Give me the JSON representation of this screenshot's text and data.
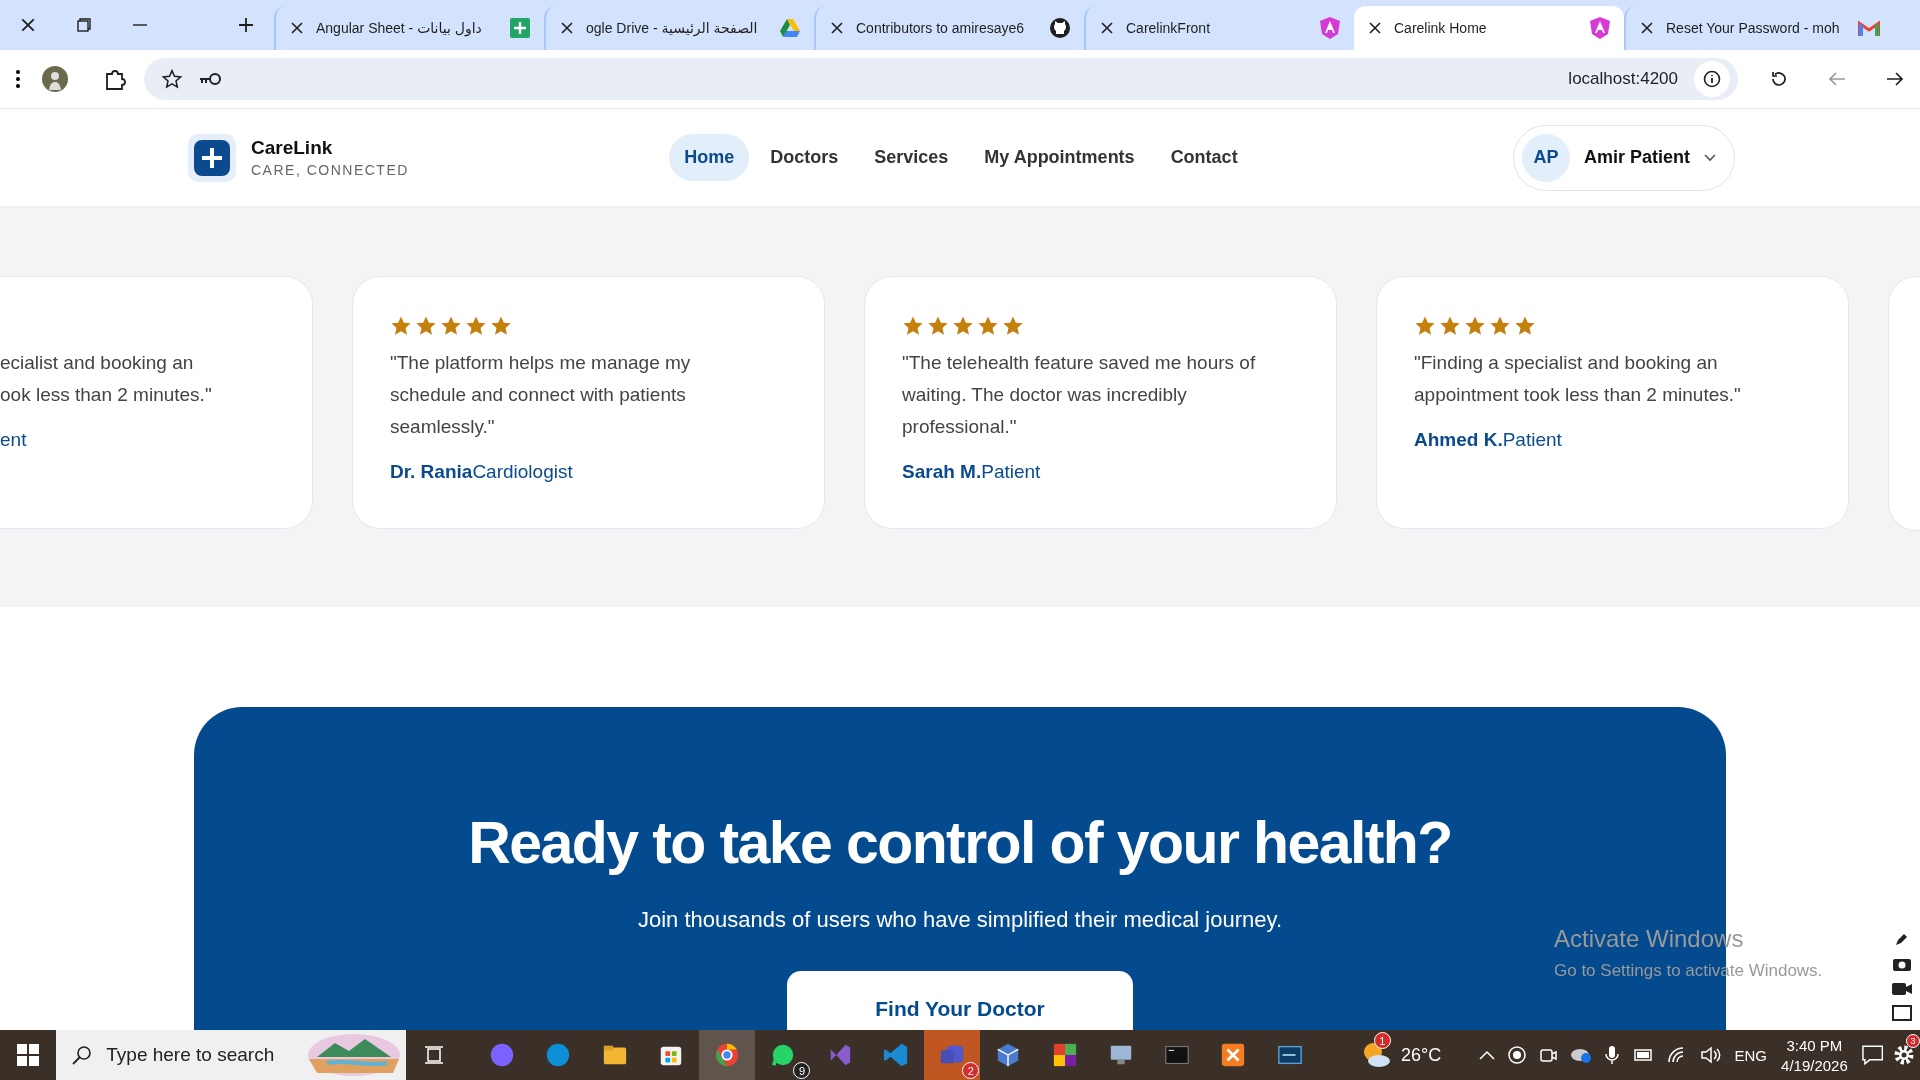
{
  "browser": {
    "tabs": [
      {
        "title": "Angular Sheet - داول بيانات",
        "selected": false
      },
      {
        "title": "ogle Drive - الصفحة الرئيسية",
        "selected": false
      },
      {
        "title": "Contributors to amiresaye6",
        "selected": false
      },
      {
        "title": "CarelinkFront",
        "selected": false
      },
      {
        "title": "Carelink Home",
        "selected": true
      },
      {
        "title": "Reset Your Password - moh",
        "selected": false
      }
    ],
    "address": "localhost:4200"
  },
  "header": {
    "brand": "CareLink",
    "tagline": "CARE, CONNECTED",
    "nav": [
      {
        "label": "Home",
        "selected": true
      },
      {
        "label": "Doctors",
        "selected": false
      },
      {
        "label": "Services",
        "selected": false
      },
      {
        "label": "My Appointments",
        "selected": false
      },
      {
        "label": "Contact",
        "selected": false
      }
    ],
    "user": {
      "initials": "AP",
      "name": "Amir Patient"
    }
  },
  "reviews": [
    {
      "kind": "cut",
      "lines": [
        "ecialist and booking an",
        "ook less than 2 minutes.\""
      ],
      "role": "ent"
    },
    {
      "kind": "full",
      "stars": 5,
      "quote": "\"The platform helps me manage my schedule and connect with patients seamlessly.\"",
      "name": "Dr. Rania",
      "role": "Cardiologist"
    },
    {
      "kind": "full",
      "stars": 5,
      "quote": "\"The telehealth feature saved me hours of waiting. The doctor was incredibly professional.\"",
      "name": "Sarah M.",
      "role": "Patient"
    },
    {
      "kind": "full",
      "stars": 5,
      "quote": "\"Finding a specialist and booking an appointment took less than 2 minutes.\"",
      "name": "Ahmed K.",
      "role": "Patient"
    }
  ],
  "cta": {
    "title": "Ready to take control of your health?",
    "subtitle": "Join thousands of users who have simplified their medical journey.",
    "button": "Find Your Doctor"
  },
  "activation": {
    "title": "Activate Windows",
    "text": "Go to Settings to activate Windows."
  },
  "taskbar": {
    "search": "Type here to search",
    "apps": [
      {
        "selected": false
      },
      {
        "selected": false
      },
      {
        "selected": false
      },
      {
        "selected": false
      },
      {
        "selected": true
      },
      {
        "selected": false,
        "badge": "9"
      },
      {
        "selected": false
      },
      {
        "selected": false
      },
      {
        "selected": true,
        "badge": "2"
      },
      {
        "selected": false
      },
      {
        "selected": false
      },
      {
        "selected": false
      },
      {
        "selected": false
      },
      {
        "selected": false
      },
      {
        "selected": false
      }
    ],
    "weather": {
      "badge": "1",
      "temp": "26°C"
    },
    "language": "ENG",
    "time": "3:40 PM",
    "date": "4/19/2026",
    "settings_badge": "3"
  }
}
